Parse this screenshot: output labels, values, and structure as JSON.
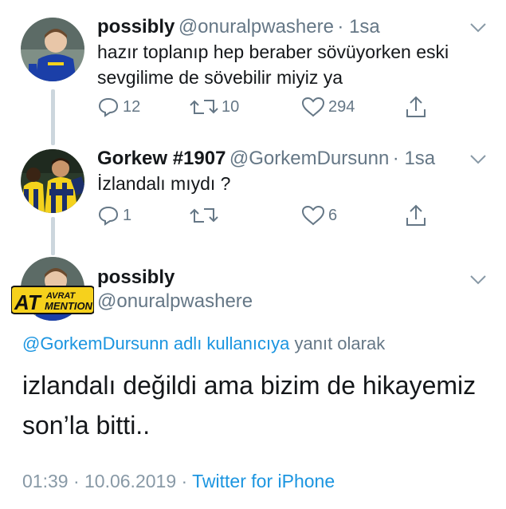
{
  "tweets": [
    {
      "name": "possibly",
      "handle": "@onuralpwashere",
      "time": "· 1sa",
      "text_line1": "hazır toplanıp hep beraber sövüyorken eski",
      "text_line2": "sevgilime de sövebilir miyiz ya",
      "replies": "12",
      "retweets": "10",
      "likes": "294"
    },
    {
      "name": "Gorkew #1907",
      "handle": "@GorkemDursunn",
      "time": "· 1sa",
      "text": "İzlandalı mıydı ?",
      "replies": "1",
      "retweets": "",
      "likes": "6"
    }
  ],
  "main_tweet": {
    "name": "possibly",
    "handle": "@onuralpwashere",
    "reply_to_handle": "@GorkemDursunn adlı kullanıcıya",
    "reply_to_suffix": "yanıt olarak",
    "text_line1": "izlandalı değildi ama bizim de hikayemiz",
    "text_line2": "son’la bitti..",
    "timestamp": "01:39 · 10.06.2019 ·",
    "source": "Twitter for iPhone"
  },
  "badge": {
    "logo_left": "AT",
    "logo_top": "AVRAT",
    "logo_bottom": "MENTION"
  },
  "colors": {
    "accent": "#1b95e0",
    "muted": "#657786",
    "thread_line": "#ccd6dd",
    "text": "#14171a"
  },
  "icons": [
    "reply-icon",
    "retweet-icon",
    "like-icon",
    "share-icon",
    "chevron-down-icon"
  ]
}
